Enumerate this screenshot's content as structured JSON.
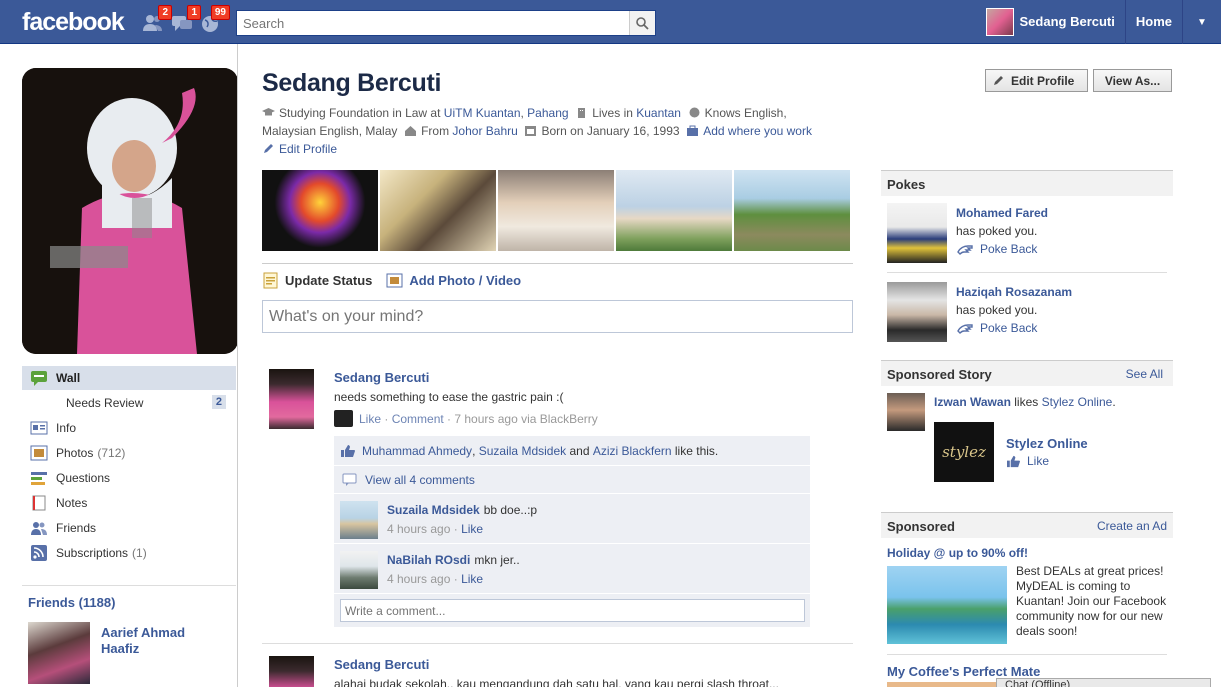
{
  "topbar": {
    "logo": "facebook",
    "friend_requests_badge": "2",
    "messages_badge": "1",
    "notifications_badge": "99",
    "search_placeholder": "Search",
    "user_name": "Sedang Bercuti",
    "home_label": "Home"
  },
  "profile": {
    "name": "Sedang Bercuti",
    "edit_profile_button": "Edit Profile",
    "view_as_button": "View As...",
    "info": {
      "studying_prefix": "Studying Foundation in Law at",
      "school": "UiTM Kuantan",
      "school_loc": "Pahang",
      "lives_prefix": "Lives in",
      "lives_in": "Kuantan",
      "knows": "Knows English, Malaysian English, Malay",
      "from_prefix": "From",
      "from": "Johor Bahru",
      "born": "Born on January 16, 1993",
      "add_work": "Add where you work",
      "edit_profile_link": "Edit Profile"
    }
  },
  "leftnav": {
    "items": [
      {
        "label": "Wall",
        "count": ""
      },
      {
        "label": "Needs Review",
        "count": "2"
      },
      {
        "label": "Info",
        "count": ""
      },
      {
        "label": "Photos",
        "count": "(712)"
      },
      {
        "label": "Questions",
        "count": ""
      },
      {
        "label": "Notes",
        "count": ""
      },
      {
        "label": "Friends",
        "count": ""
      },
      {
        "label": "Subscriptions",
        "count": "(1)"
      }
    ],
    "friends_header": "Friends (1188)",
    "friend_name": "Aarief Ahmad Haafiz"
  },
  "composer": {
    "update_status": "Update Status",
    "add_photo": "Add Photo / Video",
    "placeholder": "What's on your mind?"
  },
  "posts": [
    {
      "author": "Sedang Bercuti",
      "text": "needs something to ease the gastric pain :(",
      "like": "Like",
      "comment": "Comment",
      "time": "7 hours ago via BlackBerry",
      "likers": [
        "Muhammad Ahmedy",
        "Suzaila Mdsidek",
        "Azizi Blackfern"
      ],
      "likers_sep": ",",
      "likers_and": "and",
      "likers_suffix": "like this.",
      "view_all": "View all 4 comments",
      "comments": [
        {
          "name": "Suzaila Mdsidek",
          "text": "bb doe..:p",
          "time": "4 hours ago",
          "like": "Like"
        },
        {
          "name": "NaBilah ROsdi",
          "text": "mkn jer..",
          "time": "4 hours ago",
          "like": "Like"
        }
      ],
      "write_placeholder": "Write a comment..."
    },
    {
      "author": "Sedang Bercuti",
      "text": "alahai budak sekolah.. kau mengandung dah satu hal, yang kau pergi slash throat..."
    }
  ],
  "pokes": {
    "header": "Pokes",
    "items": [
      {
        "name": "Mohamed Fared",
        "text": "has poked you.",
        "action": "Poke Back"
      },
      {
        "name": "Haziqah Rosazanam",
        "text": "has poked you.",
        "action": "Poke Back"
      }
    ]
  },
  "sponsored_story": {
    "header": "Sponsored Story",
    "see_all": "See All",
    "user": "Izwan Wawan",
    "likes_text": "likes",
    "page": "Stylez Online",
    "page_title": "Stylez Online",
    "logo_text": "stylez",
    "like": "Like"
  },
  "sponsored": {
    "header": "Sponsored",
    "create_ad": "Create an Ad",
    "ad1_title": "Holiday @ up to 90% off!",
    "ad1_text": "Best DEALs at great prices! MyDEAL is coming to Kuantan! Join our Facebook community now for our new deals soon!",
    "ad2_title": "My Coffee's Perfect Mate"
  },
  "chat": {
    "label": "Chat (Offline)"
  }
}
